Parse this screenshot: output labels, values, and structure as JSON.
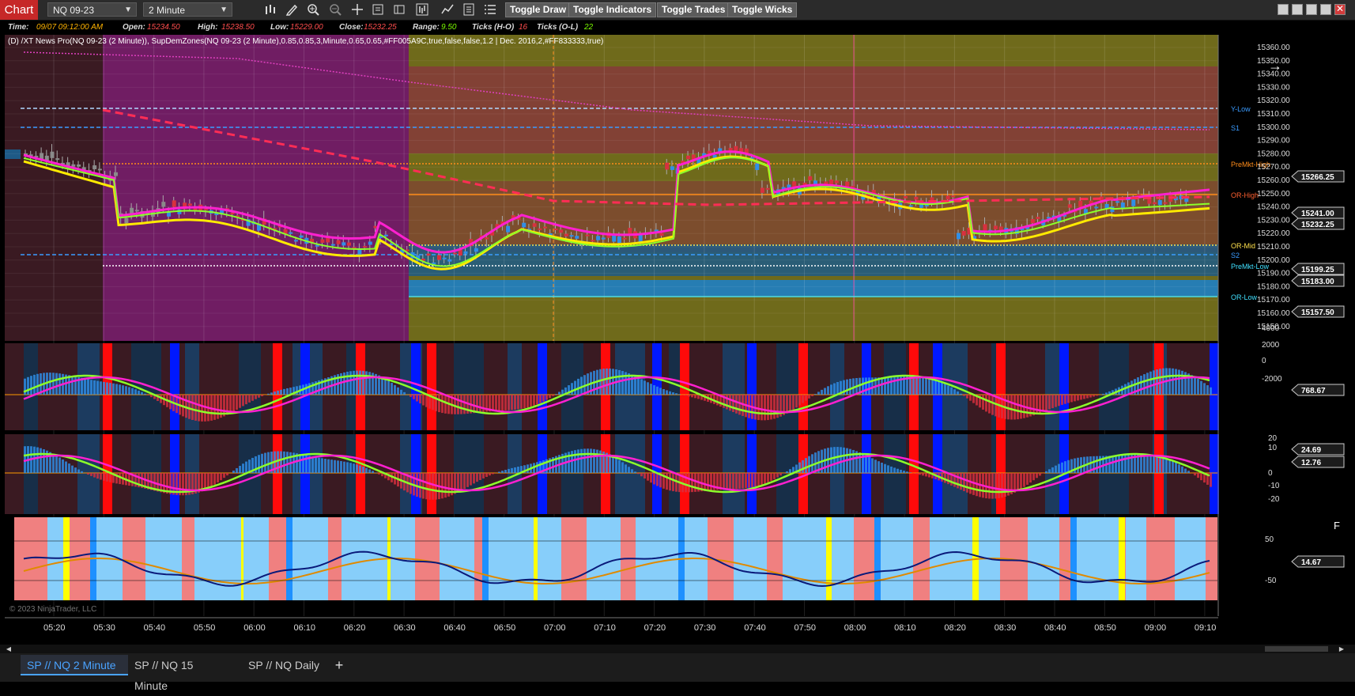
{
  "toolbar": {
    "chart_label": "Chart",
    "instrument": "NQ 09-23",
    "interval": "2 Minute",
    "toggle_draw": "Toggle Draw",
    "toggle_indicators": "Toggle Indicators",
    "toggle_trades": "Toggle Trades",
    "toggle_wicks": "Toggle Wicks",
    "close_glyph": "✕"
  },
  "info": {
    "time_label": "Time:",
    "time_value": "09/07 09:12:00 AM",
    "open_label": "Open:",
    "open_value": "15234.50",
    "high_label": "High:",
    "high_value": "15238.50",
    "low_label": "Low:",
    "low_value": "15229.00",
    "close_label": "Close:",
    "close_value": "15232.25",
    "range_label": "Range:",
    "range_value": "9.50",
    "ticks_hl_label": "Ticks (H-O)",
    "ticks_hl_value": "16",
    "ticks_ol_label": "Ticks (O-L)",
    "ticks_ol_value": "22"
  },
  "indicator_text": "(D) /XT News Pro(NQ 09-23 (2 Minute)), SupDemZones(NQ 09-23 (2 Minute),0.85,0.85,3,Minute,0.65,0.65,#FF005A9C,true,false,false,1.2 | Dec. 2016,2,#FF833333,true)",
  "price_axis": [
    "15360.00",
    "15350.00",
    "15340.00",
    "15330.00",
    "15320.00",
    "15310.00",
    "15300.00",
    "15290.00",
    "15280.00",
    "15270.00",
    "15260.00",
    "15250.00",
    "15240.00",
    "15230.00",
    "15220.00",
    "15210.00",
    "15200.00",
    "15190.00",
    "15180.00",
    "15170.00",
    "15160.00",
    "15150.00"
  ],
  "price_badges": [
    "15266.25",
    "15241.00",
    "15232.25",
    "15199.25",
    "15183.00",
    "15157.50"
  ],
  "level_labels": [
    "Y-Low",
    "S1",
    "PreMkt-High",
    "OR-High",
    "OR-Mid",
    "S2",
    "PreMkt-Low",
    "OR-Low"
  ],
  "osc1_axis": [
    "4000",
    "2000",
    "0",
    "-2000"
  ],
  "osc1_badge": "768.67",
  "osc2_axis": [
    "20",
    "10",
    "0",
    "-10",
    "-20"
  ],
  "osc2_badges": [
    "24.69",
    "12.76"
  ],
  "osc3_axis": [
    "50",
    "-50"
  ],
  "osc3_badge": "14.67",
  "osc3_corner": "F",
  "time_axis": [
    "05:20",
    "05:30",
    "05:40",
    "05:50",
    "06:00",
    "06:10",
    "06:20",
    "06:30",
    "06:40",
    "06:50",
    "07:00",
    "07:10",
    "07:20",
    "07:30",
    "07:40",
    "07:50",
    "08:00",
    "08:10",
    "08:20",
    "08:30",
    "08:40",
    "08:50",
    "09:00",
    "09:10"
  ],
  "copyright": "© 2023 NinjaTrader, LLC",
  "tabs": [
    "SP // NQ  2 Minute",
    "SP // NQ  15 Minute",
    "SP // NQ  Daily"
  ],
  "tab_add": "+",
  "colors": {
    "bull": "#2f8fe8",
    "bear": "#d9303f",
    "yellow_ma": "#ffea00",
    "magenta_ma": "#ff20d0",
    "green_ma": "#8cff2a",
    "zone_olive": "#6f6a1b",
    "zone_red": "#8a3040",
    "zone_purple": "#7a1f6f",
    "level_orange": "#ff8c1a",
    "level_blue": "#3a9bff"
  }
}
